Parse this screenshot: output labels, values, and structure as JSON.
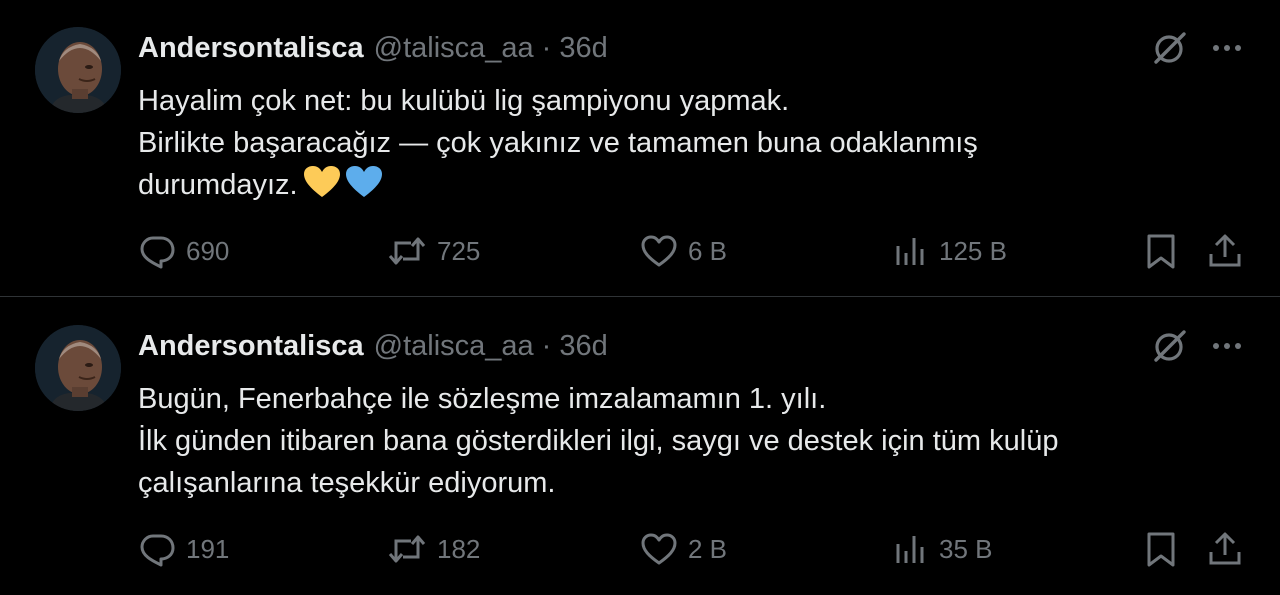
{
  "colors": {
    "background": "#000000",
    "text": "#e7e9ea",
    "muted": "#71767b",
    "divider": "#2f3336"
  },
  "tweets": [
    {
      "name": "Andersontalisca",
      "handle": "@talisca_aa",
      "separator": "·",
      "time": "36d",
      "lines": [
        "Hayalim çok net: bu kulübü lig şampiyonu yapmak.",
        "Birlikte başaracağız — çok yakınız ve tamamen buna odaklanmış",
        "durumdayız."
      ],
      "emojis": [
        "yellow-heart",
        "blue-heart"
      ],
      "replies": "690",
      "reposts": "725",
      "likes": "6 B",
      "views": "125 B"
    },
    {
      "name": "Andersontalisca",
      "handle": "@talisca_aa",
      "separator": "·",
      "time": "36d",
      "lines": [
        "Bugün, Fenerbahçe ile sözleşme imzalamamın 1. yılı.",
        "İlk günden itibaren bana gösterdikleri ilgi, saygı ve destek için tüm kulüp",
        "çalışanlarına teşekkür ediyorum."
      ],
      "replies": "191",
      "reposts": "182",
      "likes": "2 B",
      "views": "35 B"
    }
  ],
  "icons": {
    "reply": "reply-icon",
    "repost": "repost-icon",
    "like": "like-icon",
    "views": "views-icon",
    "bookmark": "bookmark-icon",
    "share": "share-icon",
    "grok": "grok-icon",
    "more": "more-icon"
  }
}
